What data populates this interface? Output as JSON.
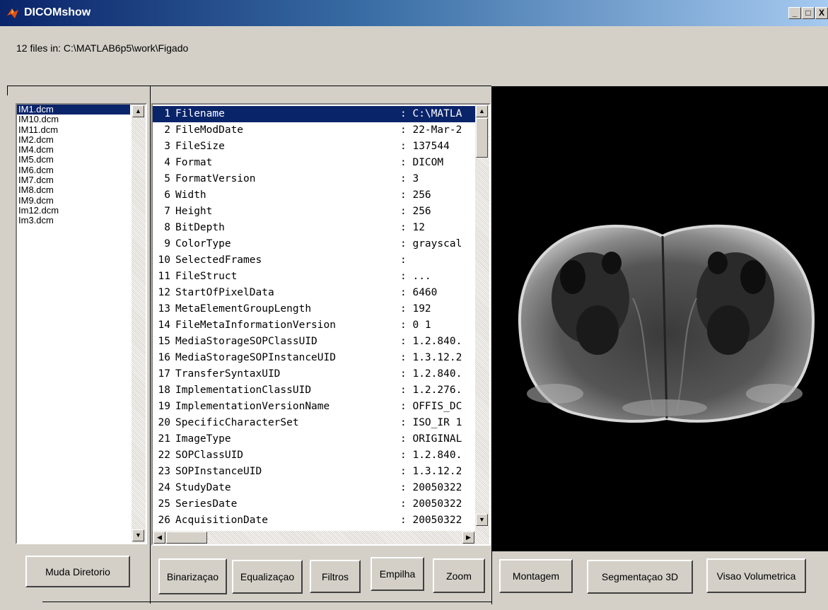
{
  "window": {
    "title": "DICOMshow",
    "controls": [
      "minimize-icon",
      "maximize-icon",
      "close-icon"
    ],
    "minimize_glyph": "_",
    "maximize_glyph": "□",
    "close_glyph": "X"
  },
  "path_label": "12 files in: C:\\MATLAB6p5\\work\\Figado",
  "file_list": {
    "items": [
      "IM1.dcm",
      "IM10.dcm",
      "IM11.dcm",
      "IM2.dcm",
      "IM4.dcm",
      "IM5.dcm",
      "IM6.dcm",
      "IM7.dcm",
      "IM8.dcm",
      "IM9.dcm",
      "Im12.dcm",
      "Im3.dcm"
    ],
    "selected": "IM1.dcm"
  },
  "dicom_info": {
    "rows": [
      {
        "num": "1",
        "key": "Filename",
        "val": ": C:\\MATLA"
      },
      {
        "num": "2",
        "key": "FileModDate",
        "val": ": 22-Mar-2"
      },
      {
        "num": "3",
        "key": "FileSize",
        "val": ": 137544"
      },
      {
        "num": "4",
        "key": "Format",
        "val": ": DICOM"
      },
      {
        "num": "5",
        "key": "FormatVersion",
        "val": ": 3"
      },
      {
        "num": "6",
        "key": "Width",
        "val": ": 256"
      },
      {
        "num": "7",
        "key": "Height",
        "val": ": 256"
      },
      {
        "num": "8",
        "key": "BitDepth",
        "val": ": 12"
      },
      {
        "num": "9",
        "key": "ColorType",
        "val": ": grayscal"
      },
      {
        "num": "10",
        "key": "SelectedFrames",
        "val": ":"
      },
      {
        "num": "11",
        "key": "FileStruct",
        "val": ": ..."
      },
      {
        "num": "12",
        "key": "StartOfPixelData",
        "val": ": 6460"
      },
      {
        "num": "13",
        "key": "MetaElementGroupLength",
        "val": ": 192"
      },
      {
        "num": "14",
        "key": "FileMetaInformationVersion",
        "val": ": 0  1"
      },
      {
        "num": "15",
        "key": "MediaStorageSOPClassUID",
        "val": ": 1.2.840."
      },
      {
        "num": "16",
        "key": "MediaStorageSOPInstanceUID",
        "val": ": 1.3.12.2"
      },
      {
        "num": "17",
        "key": "TransferSyntaxUID",
        "val": ": 1.2.840."
      },
      {
        "num": "18",
        "key": "ImplementationClassUID",
        "val": ": 1.2.276."
      },
      {
        "num": "19",
        "key": "ImplementationVersionName",
        "val": ": OFFIS_DC"
      },
      {
        "num": "20",
        "key": "SpecificCharacterSet",
        "val": ": ISO_IR 1"
      },
      {
        "num": "21",
        "key": "ImageType",
        "val": ": ORIGINAL"
      },
      {
        "num": "22",
        "key": "SOPClassUID",
        "val": ": 1.2.840."
      },
      {
        "num": "23",
        "key": "SOPInstanceUID",
        "val": ": 1.3.12.2"
      },
      {
        "num": "24",
        "key": "StudyDate",
        "val": ": 20050322"
      },
      {
        "num": "25",
        "key": "SeriesDate",
        "val": ": 20050322"
      },
      {
        "num": "26",
        "key": "AcquisitionDate",
        "val": ": 20050322"
      }
    ]
  },
  "buttons": {
    "muda_diretorio": "Muda Diretorio",
    "binarizacao": "Binarizaçao",
    "equalizacao": "Equalizaçao",
    "filtros": "Filtros",
    "empilha": "Empilha",
    "zoom": "Zoom",
    "montagem": "Montagem",
    "segmentacao_3d": "Segmentaçao 3D",
    "visao_volumetrica": "Visao Volumetrica"
  },
  "scroll_glyphs": {
    "up": "▲",
    "down": "▼",
    "left": "◀",
    "right": "▶"
  },
  "colors": {
    "selection": "#0a246a",
    "titlebar_start": "#0a246a",
    "titlebar_end": "#a6caf0",
    "face": "#d4d0c8"
  }
}
